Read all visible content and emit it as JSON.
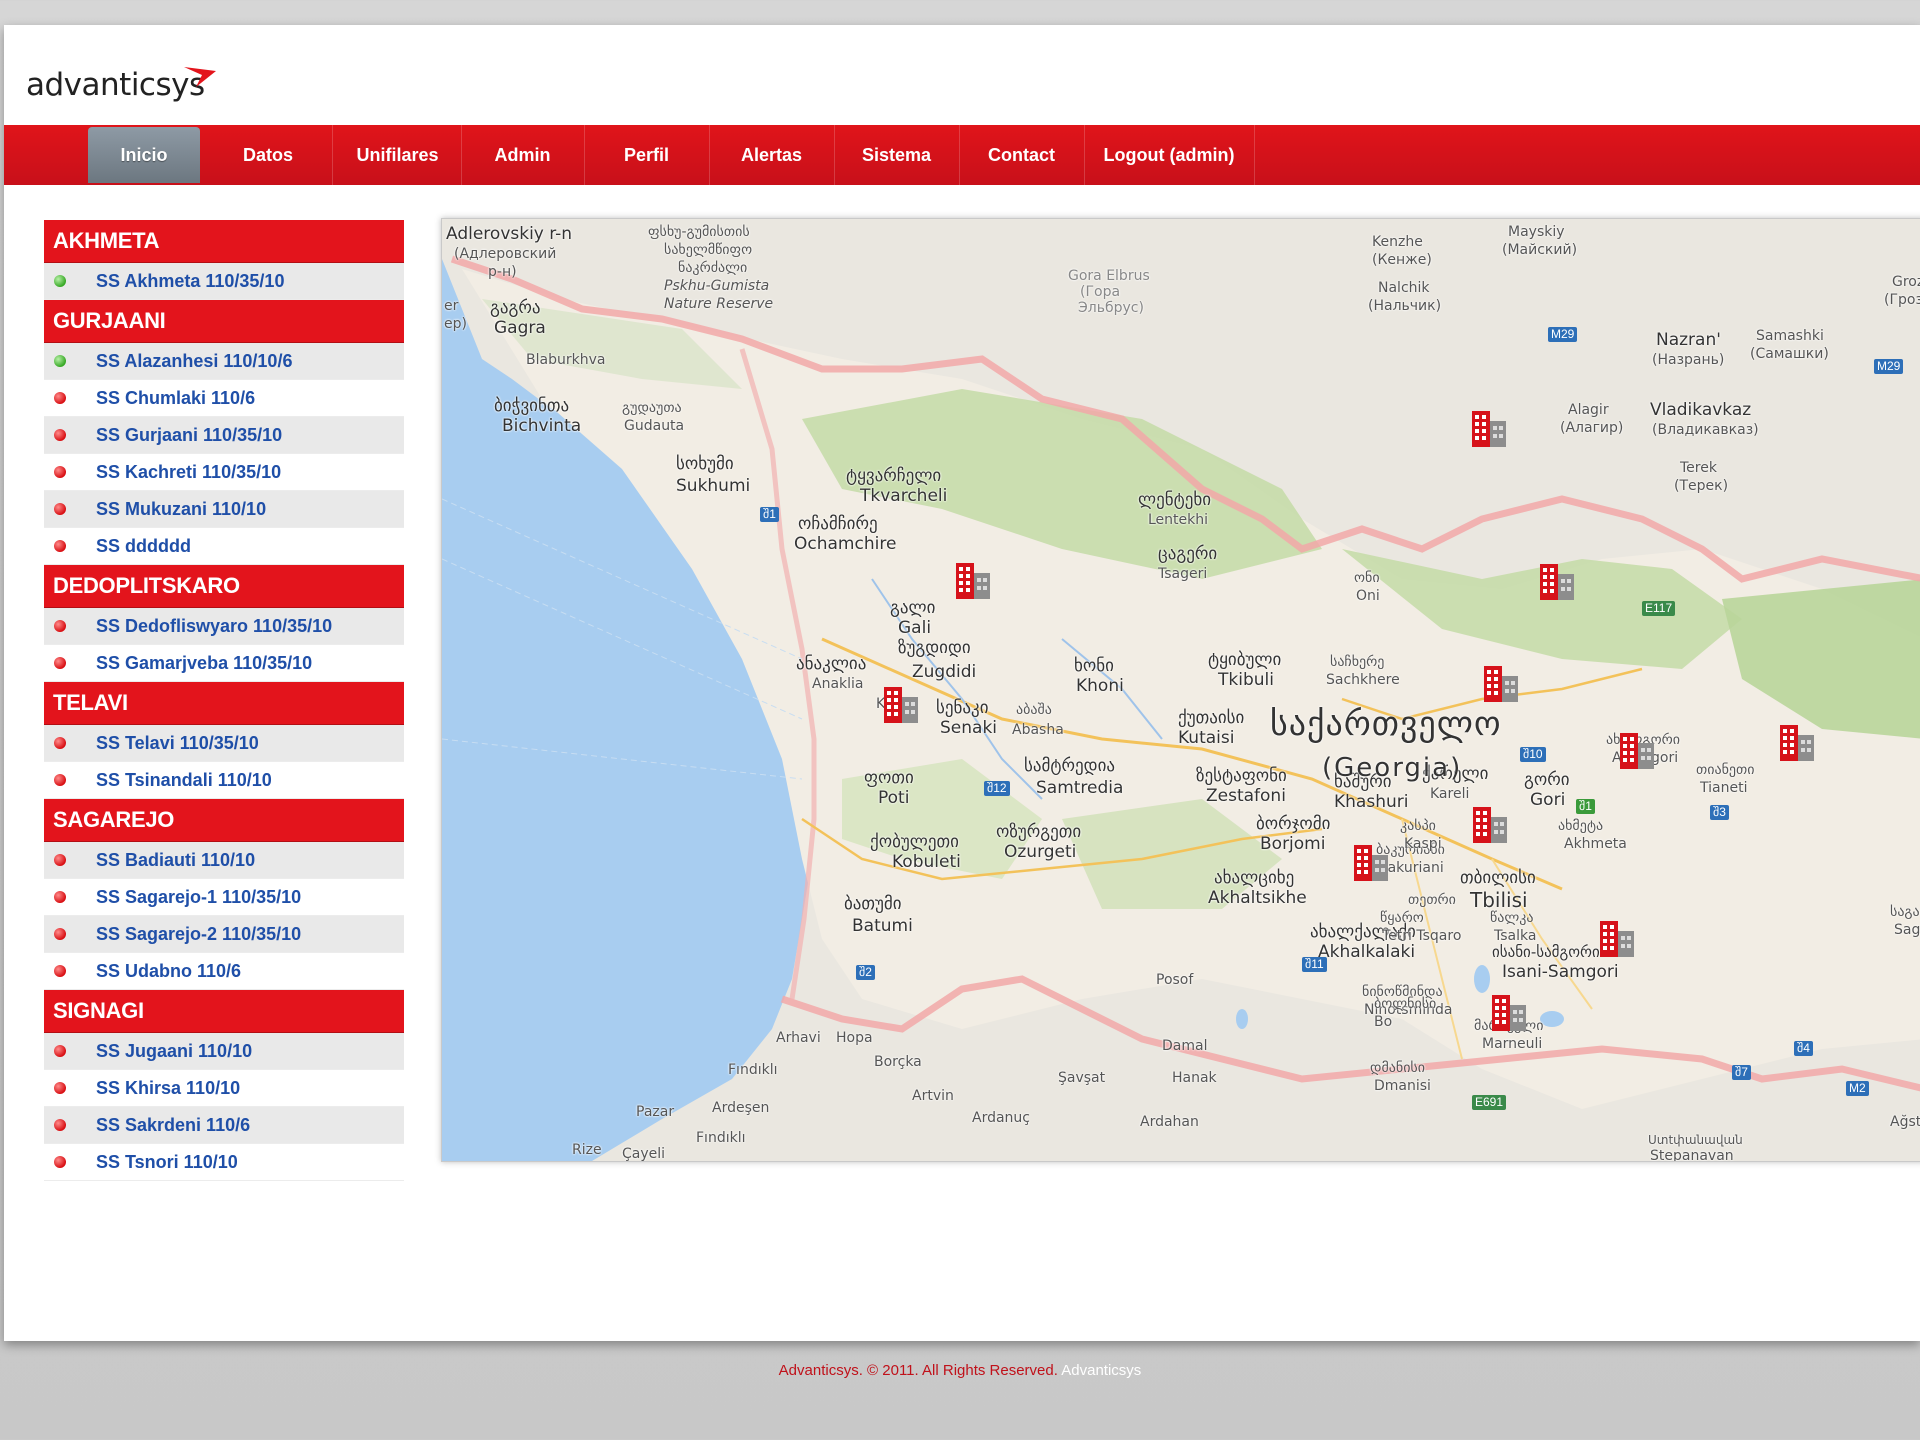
{
  "brand": {
    "name": "advanticsys",
    "accent": "#e3141c"
  },
  "nav": {
    "items": [
      {
        "label": "Inicio",
        "active": true
      },
      {
        "label": "Datos",
        "active": false
      },
      {
        "label": "Unifilares",
        "active": false
      },
      {
        "label": "Admin",
        "active": false
      },
      {
        "label": "Perfil",
        "active": false
      },
      {
        "label": "Alertas",
        "active": false
      },
      {
        "label": "Sistema",
        "active": false
      },
      {
        "label": "Contact",
        "active": false
      },
      {
        "label": "Logout (admin)",
        "active": false
      }
    ]
  },
  "sidebar": {
    "groups": [
      {
        "name": "AKHMETA",
        "items": [
          {
            "label": "SS Akhmeta 110/35/10",
            "status": "green"
          }
        ]
      },
      {
        "name": "GURJAANI",
        "items": [
          {
            "label": "SS Alazanhesi 110/10/6",
            "status": "green"
          },
          {
            "label": "SS Chumlaki 110/6",
            "status": "red"
          },
          {
            "label": "SS Gurjaani 110/35/10",
            "status": "red"
          },
          {
            "label": "SS Kachreti 110/35/10",
            "status": "red"
          },
          {
            "label": "SS Mukuzani 110/10",
            "status": "red"
          },
          {
            "label": "SS dddddd",
            "status": "red"
          }
        ]
      },
      {
        "name": "DEDOPLITSKARO",
        "items": [
          {
            "label": "SS Dedofliswyaro 110/35/10",
            "status": "red"
          },
          {
            "label": "SS Gamarjveba 110/35/10",
            "status": "red"
          }
        ]
      },
      {
        "name": "TELAVI",
        "items": [
          {
            "label": "SS Telavi 110/35/10",
            "status": "red"
          },
          {
            "label": "SS Tsinandali 110/10",
            "status": "red"
          }
        ]
      },
      {
        "name": "SAGAREJO",
        "items": [
          {
            "label": "SS Badiauti 110/10",
            "status": "red"
          },
          {
            "label": "SS Sagarejo-1 110/35/10",
            "status": "red"
          },
          {
            "label": "SS Sagarejo-2 110/35/10",
            "status": "red"
          },
          {
            "label": "SS Udabno 110/6",
            "status": "red"
          }
        ]
      },
      {
        "name": "SIGNAGI",
        "items": [
          {
            "label": "SS Jugaani 110/10",
            "status": "red"
          },
          {
            "label": "SS Khirsa 110/10",
            "status": "red"
          },
          {
            "label": "SS Sakrdeni 110/6",
            "status": "red"
          },
          {
            "label": "SS Tsnori 110/10",
            "status": "red"
          }
        ]
      }
    ],
    "status_colors": {
      "green": "#36a824",
      "red": "#d80e12"
    }
  },
  "map": {
    "country_label": "საქართველო",
    "country_sub": "(Georgia)",
    "labels": [
      "Adlerovskiy r-n",
      "(Адлеровский",
      "р-н)",
      "ფსხუ-გუმისთის",
      "სახელმწიფო",
      "ნაკრძალი",
      "Pskhu-Gumista",
      "Nature Reserve",
      "გაგრა",
      "Gagra",
      "Blaburkhva",
      "ბიჭვინთა",
      "Bichvinta",
      "გუდაუთა",
      "Gudauta",
      "სოხუმი",
      "Sukhumi",
      "ტყვარჩელი",
      "Tkvarcheli",
      "ოჩამჩირე",
      "Ochamchire",
      "გალი",
      "Gali",
      "ზუგდიდი",
      "Zugdidi",
      "ანაკლია",
      "Anaklia",
      "Kulevi",
      "სენაკი",
      "Senaki",
      "აბაშა",
      "Abasha",
      "ფოთი",
      "Poti",
      "სამტრედია",
      "Samtredia",
      "ქობულეთი",
      "Kobuleti",
      "ოზურგეთი",
      "Ozurgeti",
      "ბათუმი",
      "Batumi",
      "ლენტეხი",
      "Lentekhi",
      "ცაგერი",
      "Tsageri",
      "ონი",
      "Oni",
      "ხონი",
      "Khoni",
      "ტყიბული",
      "Tkibuli",
      "საჩხერე",
      "Sachkhere",
      "ქუთაისი",
      "Kutaisi",
      "ზესტაფონი",
      "Zestafoni",
      "ხაშური",
      "Khashuri",
      "ქარელი",
      "Kareli",
      "გორი",
      "Gori",
      "ბორჯომი",
      "Borjomi",
      "ბაკურიანი",
      "Bakuriani",
      "ახალციხე",
      "Akhaltsikhe",
      "ახალქალაქი",
      "Akhalkalaki",
      "ნინოწმინდა",
      "Ninotsminda",
      "წალკა",
      "Tsalka",
      "თეთრი",
      "წყარო",
      "Tetri Tsqaro",
      "ისანი-სამგორი",
      "Isani-Samgori",
      "თბილისი",
      "Tbilisi",
      "კასპი",
      "Kaspi",
      "ახალგორი",
      "Akhalgori",
      "თიანეთი",
      "Tianeti",
      "ახმეტა",
      "Akhmeta",
      "მარნეული",
      "Marneuli",
      "დმანისი",
      "Dmanisi",
      "ბოლნისი",
      "Bo",
      "Kenzhe",
      "(Кенже)",
      "Nalchik",
      "(Нальчик)",
      "Mayskiy",
      "(Майский)",
      "Gora Elbrus",
      "(Гора",
      "Эльбрус)",
      "Nazran'",
      "(Назрань)",
      "Samashki",
      "(Самашки)",
      "Alagir",
      "(Алагир)",
      "Vladikavkaz",
      "(Владикавказ)",
      "Terek",
      "(Терек)",
      "Groz",
      "(Гроз",
      "Saga",
      "საგა",
      "Arhavi",
      "Hopa",
      "Borçka",
      "Fındıklı",
      "Pazar",
      "Ardeşen",
      "Fındıklı",
      "Rize",
      "Çayeli",
      "Artvin",
      "Ardanuç",
      "Şavşat",
      "Posof",
      "Damal",
      "Hanak",
      "Ardahan",
      "Ağstaf",
      "Stepanavan",
      "Uտtփանավան",
      "ep)",
      "er"
    ],
    "roads": [
      "შ1",
      "შ2",
      "შ12",
      "შ10",
      "შ11",
      "შ1",
      "შ3",
      "შ4",
      "შ7",
      "M29",
      "M29",
      "E117",
      "E691",
      "M2"
    ],
    "marker_count": 12
  },
  "footer": {
    "text": "Advanticsys. © 2011. All Rights Reserved.",
    "link": "Advanticsys"
  }
}
